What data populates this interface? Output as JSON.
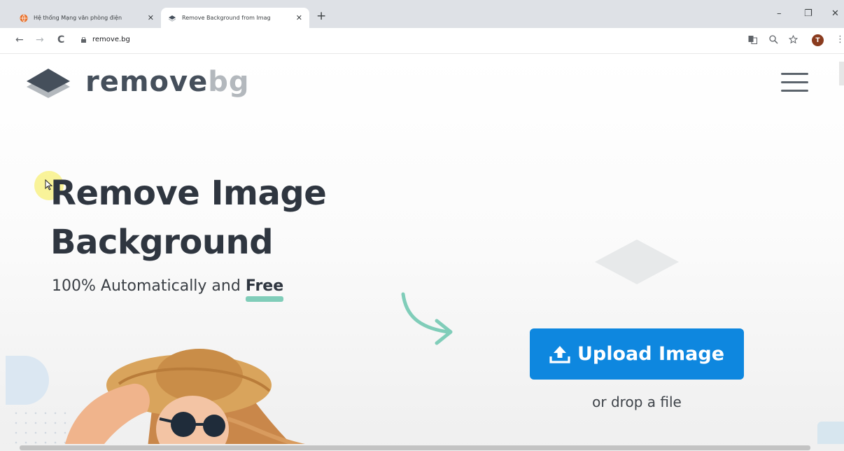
{
  "browser": {
    "tabs": [
      {
        "title": "Hệ thống Mạng văn phòng điện",
        "active": false,
        "favicon": "orange-globe-icon"
      },
      {
        "title": "Remove Background from Imag",
        "active": true,
        "favicon": "removebg-layers-icon"
      }
    ],
    "new_tab": "+",
    "close_glyph": "✕",
    "window_controls": {
      "minimize": "–",
      "restore": "❐",
      "close": "✕"
    },
    "nav": {
      "back": "←",
      "forward": "→",
      "reload": "C"
    },
    "url": "remove.bg",
    "profile_initial": "T",
    "toolbar_icons": [
      "translate-icon",
      "zoom-icon",
      "star-icon"
    ]
  },
  "site": {
    "logo": {
      "word1": "remove",
      "word2": "bg"
    },
    "menu_icon": "hamburger-icon",
    "headline": {
      "line1": "Remove Image",
      "line2": "Background"
    },
    "subline": {
      "text": "100% Automatically and",
      "emphasis": "Free"
    },
    "upload_button": "Upload Image",
    "drop_text": "or drop a file"
  },
  "colors": {
    "accent_blue": "#0e87df",
    "teal": "#80cdb9",
    "logo_dark": "#454f5b",
    "logo_light": "#b3b8bd",
    "heading": "#2f3640"
  }
}
